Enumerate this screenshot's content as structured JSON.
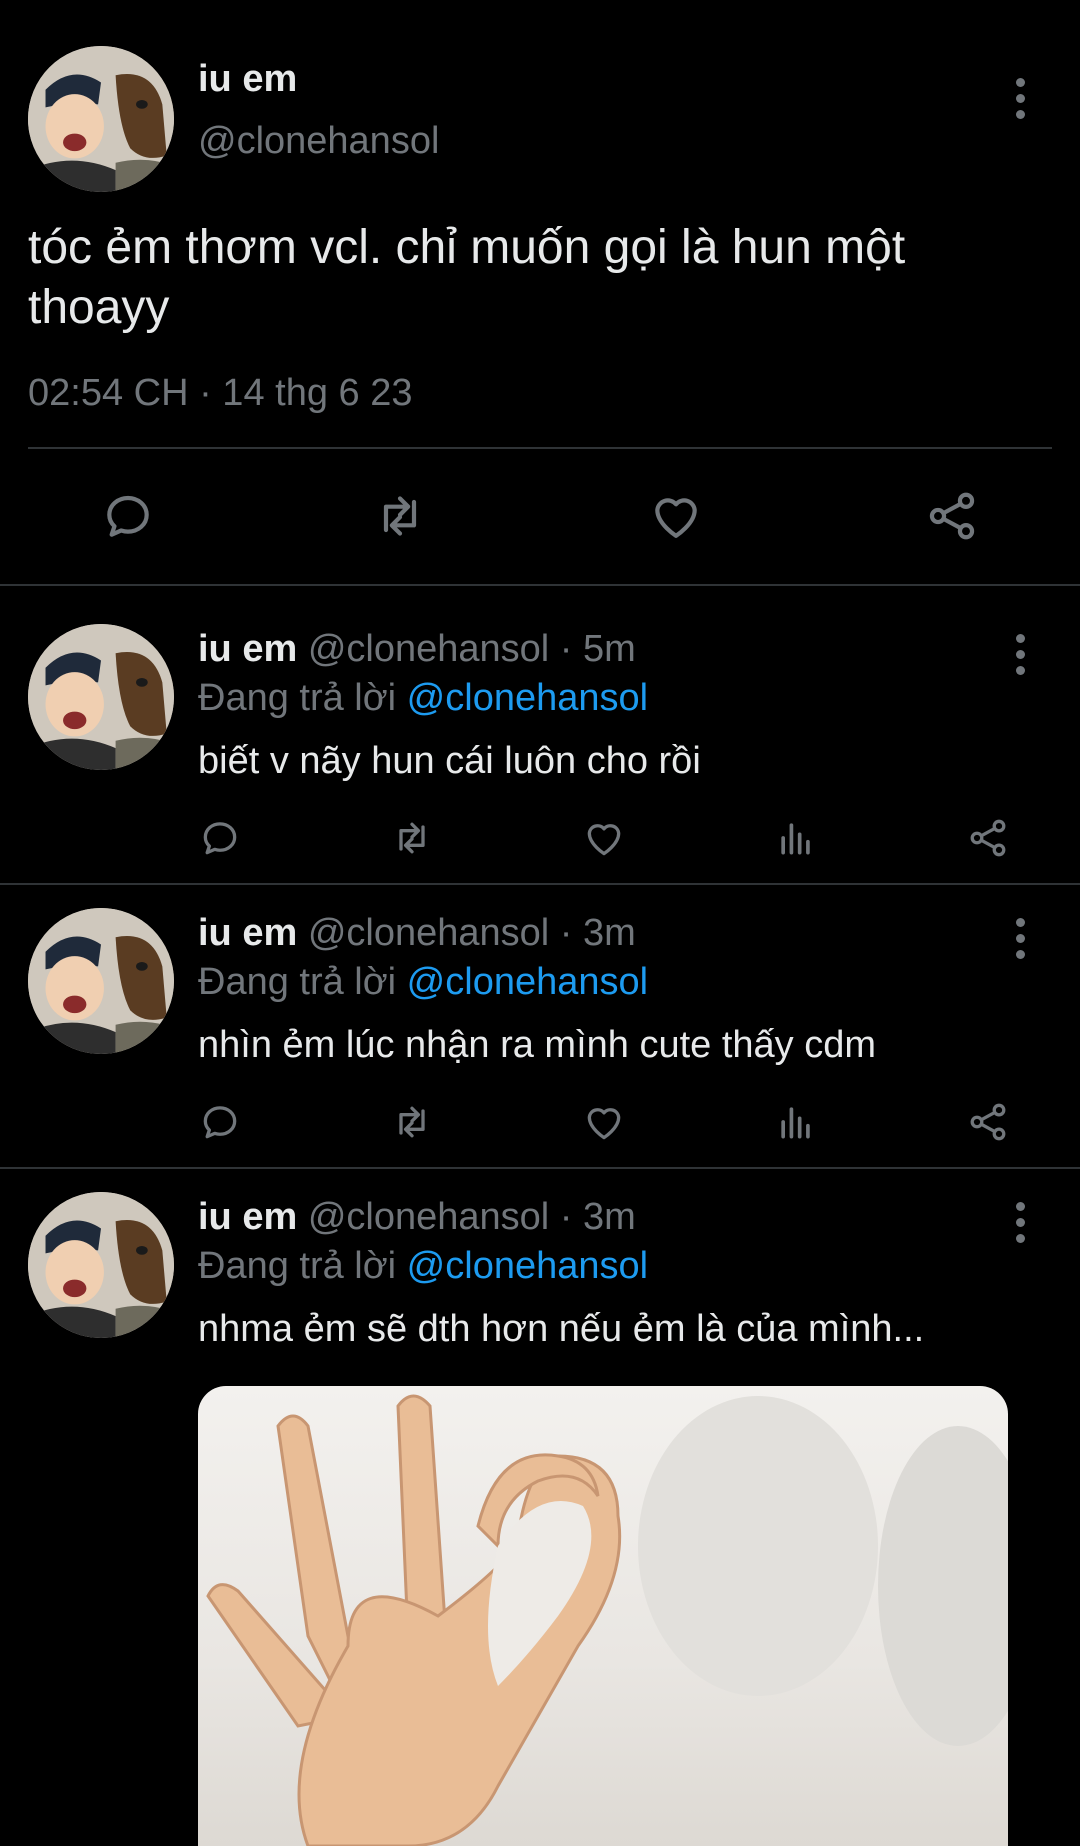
{
  "main_tweet": {
    "display_name": "iu em",
    "handle": "@clonehansol",
    "text_line1": "tóc ẻm thơm vcl. chỉ muốn gọi là hun một",
    "text_line2": "thoayy",
    "timestamp": "02:54 CH · 14 thg 6 23"
  },
  "replies": [
    {
      "display_name": "iu em",
      "handle_time": "@clonehansol · 5m",
      "replying_prefix": "Đang trả lời",
      "replying_to": "@clonehansol",
      "text": "biết v nãy hun cái luôn cho rồi"
    },
    {
      "display_name": "iu em",
      "handle_time": "@clonehansol · 3m",
      "replying_prefix": "Đang trả lời",
      "replying_to": "@clonehansol",
      "text": "nhìn ẻm lúc nhận ra mình cute thấy cdm"
    },
    {
      "display_name": "iu em",
      "handle_time": "@clonehansol · 3m",
      "replying_prefix": "Đang trả lời",
      "replying_to": "@clonehansol",
      "text": "nhma ẻm sẽ dth hơn nếu ẻm là của mình..."
    }
  ],
  "icons": [
    "reply-icon",
    "retweet-icon",
    "like-icon",
    "analytics-icon",
    "share-icon",
    "more-icon"
  ],
  "colors": {
    "background": "#000000",
    "text": "#e7e9ea",
    "muted": "#71767b",
    "link": "#1d9bf0",
    "divider": "#2f3336"
  }
}
